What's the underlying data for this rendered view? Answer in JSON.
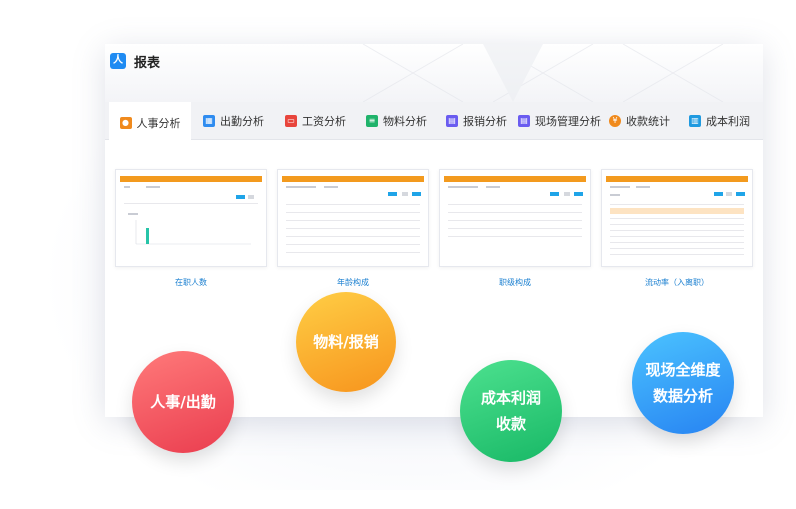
{
  "app": {
    "title": "报表",
    "logo_glyph": "人"
  },
  "tabs": [
    {
      "label": "人事分析",
      "icon": "person-icon",
      "color": "#f08a1d",
      "active": true
    },
    {
      "label": "出勤分析",
      "icon": "calendar-icon",
      "color": "#2f8cf0"
    },
    {
      "label": "工资分析",
      "icon": "wallet-icon",
      "color": "#e8453c"
    },
    {
      "label": "物料分析",
      "icon": "document-icon",
      "color": "#20b36b"
    },
    {
      "label": "报销分析",
      "icon": "receipt-icon",
      "color": "#6a5cf0"
    },
    {
      "label": "现场管理分析",
      "icon": "clipboard-icon",
      "color": "#6a5cf0"
    },
    {
      "label": "收款统计",
      "icon": "money-bag-icon",
      "color": "#f08a1d"
    },
    {
      "label": "成本利润",
      "icon": "ledger-icon",
      "color": "#1f9ae0"
    }
  ],
  "reports": [
    {
      "caption": "在职人数",
      "kind": "bar"
    },
    {
      "caption": "年龄构成",
      "kind": "table"
    },
    {
      "caption": "职级构成",
      "kind": "table"
    },
    {
      "caption": "流动率（入离职）",
      "kind": "table-highlight"
    }
  ],
  "bubbles": [
    {
      "line1": "物料/报销",
      "line2": "",
      "gradient": [
        "#ffce45",
        "#f7941d"
      ]
    },
    {
      "line1": "人事/出勤",
      "line2": "",
      "gradient": [
        "#ff7a7a",
        "#ea3d4f"
      ]
    },
    {
      "line1": "成本利润",
      "line2": "收款",
      "gradient": [
        "#4de18f",
        "#18b866"
      ]
    },
    {
      "line1": "现场全维度",
      "line2": "数据分析",
      "gradient": [
        "#4bc3ff",
        "#2783f2"
      ]
    }
  ],
  "colors": {
    "accent": "#f39a1e",
    "link": "#1a7fd0",
    "button": "#1fa4e8"
  }
}
